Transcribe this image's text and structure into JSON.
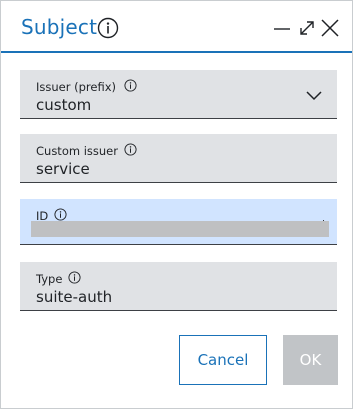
{
  "dialog": {
    "title": "Subject",
    "icons": {
      "title_info": "info-icon",
      "minimize": "minimize-icon",
      "maximize": "maximize-icon",
      "close": "close-icon"
    },
    "accent_color": "#1a72b8"
  },
  "fields": {
    "issuer": {
      "label": "Issuer (prefix)",
      "value": "custom",
      "icon": "chevron-down-icon"
    },
    "custom_issuer": {
      "label": "Custom issuer",
      "value": "service"
    },
    "id": {
      "label": "ID",
      "value": ""
    },
    "type": {
      "label": "Type",
      "value": "suite-auth"
    }
  },
  "actions": {
    "cancel_label": "Cancel",
    "ok_label": "OK"
  }
}
